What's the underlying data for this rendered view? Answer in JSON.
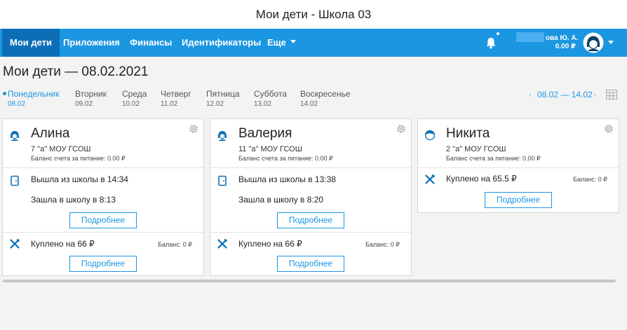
{
  "window": {
    "title": "Мои дети - Школа 03"
  },
  "nav": {
    "items": [
      {
        "label": "Мои дети",
        "active": true
      },
      {
        "label": "Приложения"
      },
      {
        "label": "Финансы"
      },
      {
        "label": "Идентификаторы"
      },
      {
        "label": "Еще"
      }
    ],
    "user": {
      "name": "ова Ю. А.",
      "balance": "0.00 ₽"
    }
  },
  "page": {
    "title": "Мои дети — 08.02.2021"
  },
  "week": {
    "days": [
      {
        "name": "Понедельник",
        "date": "08.02",
        "active": true
      },
      {
        "name": "Вторник",
        "date": "09.02"
      },
      {
        "name": "Среда",
        "date": "10.02"
      },
      {
        "name": "Четверг",
        "date": "11.02"
      },
      {
        "name": "Пятница",
        "date": "12.02"
      },
      {
        "name": "Суббота",
        "date": "13.02"
      },
      {
        "name": "Воскресенье",
        "date": "14.02"
      }
    ],
    "prev": "‹",
    "range": "08.02 — 14.02",
    "next": "›"
  },
  "children": [
    {
      "name": "Алина",
      "class": "7 \"а\" МОУ ГСОШ",
      "meal_balance": "Баланс счета за питание: 0.00 ₽",
      "gender": "girl",
      "attendance": {
        "out": "Вышла из школы в 14:34",
        "in": "Зашла в школу в 8:13",
        "details": "Подробнее"
      },
      "meal": {
        "purchased": "Куплено на 66 ₽",
        "balance": "Баланс: 0 ₽",
        "details": "Подробнее"
      }
    },
    {
      "name": "Валерия",
      "class": "11 \"а\" МОУ ГСОШ",
      "meal_balance": "Баланс счета за питание: 0.00 ₽",
      "gender": "girl",
      "attendance": {
        "out": "Вышла из школы в 13:38",
        "in": "Зашла в школу в 8:20",
        "details": "Подробнее"
      },
      "meal": {
        "purchased": "Куплено на 66 ₽",
        "balance": "Баланс: 0 ₽",
        "details": "Подробнее"
      }
    },
    {
      "name": "Никита",
      "class": "2 \"а\" МОУ ГСОШ",
      "meal_balance": "Баланс счета за питание: 0.00 ₽",
      "gender": "boy",
      "meal": {
        "purchased": "Куплено на 65.5 ₽",
        "balance": "Баланс: 0 ₽",
        "details": "Подробнее"
      }
    }
  ],
  "colors": {
    "primary": "#1b96e0",
    "nav_active": "#0c6fb6",
    "icon": "#0a6fb3"
  }
}
